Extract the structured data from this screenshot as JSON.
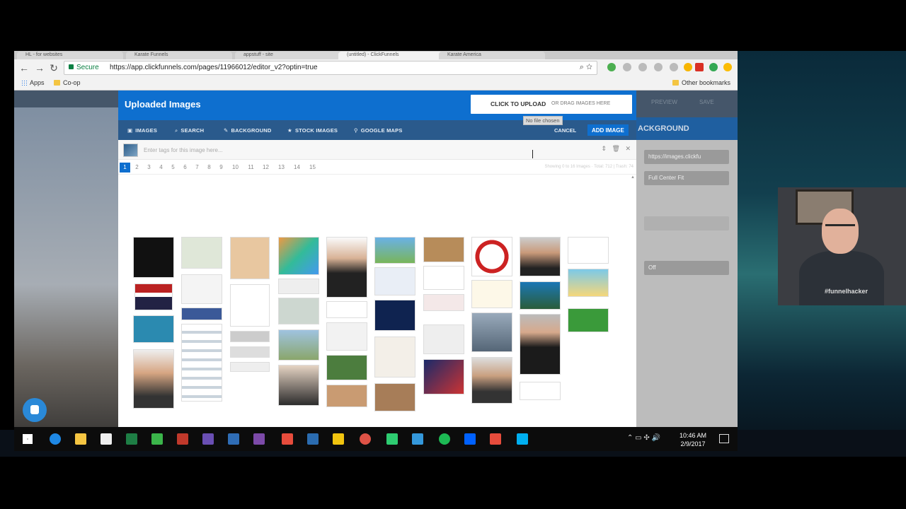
{
  "browser": {
    "tabs": [
      "HL - for websites",
      "Karate Funnels",
      "appstuff - site",
      "(untitled) - ClickFunnels",
      "Karate America"
    ],
    "secure_label": "Secure",
    "url": "https://app.clickfunnels.com/pages/11966012/editor_v2?optin=true",
    "bookmarks": {
      "apps": "Apps",
      "coop": "Co-op",
      "other": "Other bookmarks"
    }
  },
  "editor": {
    "background_title": "ACKGROUND",
    "preview": "PREVIEW",
    "save": "SAVE",
    "image_url_field": "https://images.clickfu",
    "fit_select": "Full Center Fit",
    "off_select": "Off"
  },
  "modal": {
    "title": "Uploaded Images",
    "upload_label": "CLICK TO UPLOAD",
    "drag_label": "OR DRAG IMAGES HERE",
    "no_file": "No file chosen",
    "tabs": [
      {
        "icon": "▣",
        "label": "IMAGES"
      },
      {
        "icon": "⌕",
        "label": "SEARCH"
      },
      {
        "icon": "✎",
        "label": "BACKGROUND"
      },
      {
        "icon": "★",
        "label": "STOCK IMAGES"
      },
      {
        "icon": "⚲",
        "label": "GOOGLE MAPS"
      }
    ],
    "cancel": "CANCEL",
    "add_image": "ADD IMAGE",
    "tag_placeholder": "Enter tags for this image here...",
    "pages": [
      "1",
      "2",
      "3",
      "4",
      "5",
      "6",
      "7",
      "8",
      "9",
      "10",
      "11",
      "12",
      "13",
      "14",
      "15"
    ],
    "current_page": "1",
    "showing": "Showing 0 to 16 Images · Total: 712 | Trash: 74"
  },
  "webcam": {
    "shirt_text": "#funnelhacker"
  },
  "taskbar": {
    "time": "10:46 AM",
    "date": "2/9/2017"
  },
  "colors": {
    "header_blue": "#0e6fcf",
    "tab_bar": "#2a5a8c",
    "page_bg": "#55687a"
  }
}
